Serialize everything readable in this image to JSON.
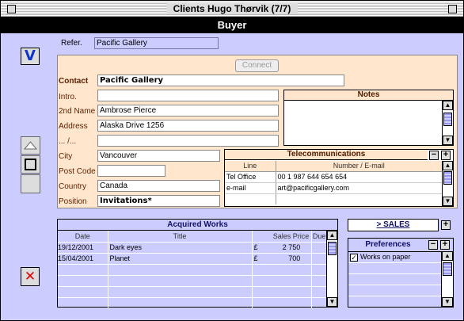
{
  "window": {
    "title": "Clients Hugo Thørvik (7/7)"
  },
  "header": {
    "title": "Buyer"
  },
  "refer": {
    "label": "Refer.",
    "value": "Pacific Gallery"
  },
  "connect_label": "Connect",
  "contact": {
    "label": "Contact",
    "value": "Pacific Gallery",
    "intro_label": "Intro.",
    "intro_value": "",
    "second_name_label": "2nd Name",
    "second_name_value": "Ambrose Pierce",
    "address_label": "Address",
    "address_value": "Alaska Drive 1256",
    "address2_label": "... /...",
    "address2_value": "",
    "city_label": "City",
    "city_value": "Vancouver",
    "postcode_label": "Post Code",
    "postcode_value": "",
    "country_label": "Country",
    "country_value": "Canada",
    "position_label": "Position",
    "position_value": "Invitations*"
  },
  "notes": {
    "title": "Notes"
  },
  "telecom": {
    "title": "Telecommunications",
    "col_line": "Line",
    "col_number": "Number / E-mail",
    "rows": [
      {
        "line": "Tel Office",
        "number": "00 1 987 644 654 654"
      },
      {
        "line": "e-mail",
        "number": "art@pacificgallery.com"
      }
    ]
  },
  "works": {
    "title": "Acquired Works",
    "columns": {
      "date": "Date",
      "title": "Title",
      "price": "Sales Price",
      "due": "Due"
    },
    "rows": [
      {
        "date": "19/12/2001",
        "title": "Dark eyes",
        "currency": "£",
        "price": "2 750"
      },
      {
        "date": "15/04/2001",
        "title": "Planet",
        "currency": "£",
        "price": "700"
      }
    ]
  },
  "sales": {
    "label": "> SALES",
    "add": "+"
  },
  "preferences": {
    "title": "Preferences",
    "items": [
      {
        "label": "Works on paper",
        "checked": true
      }
    ]
  },
  "buttons": {
    "validate": "V",
    "cancel": "✕",
    "minus": "−",
    "plus": "+"
  },
  "colors": {
    "window_bg": "#ccccff",
    "panel_bg": "#ffe6cc",
    "header_bg": "#000000",
    "cancel_red": "#dd0000"
  }
}
